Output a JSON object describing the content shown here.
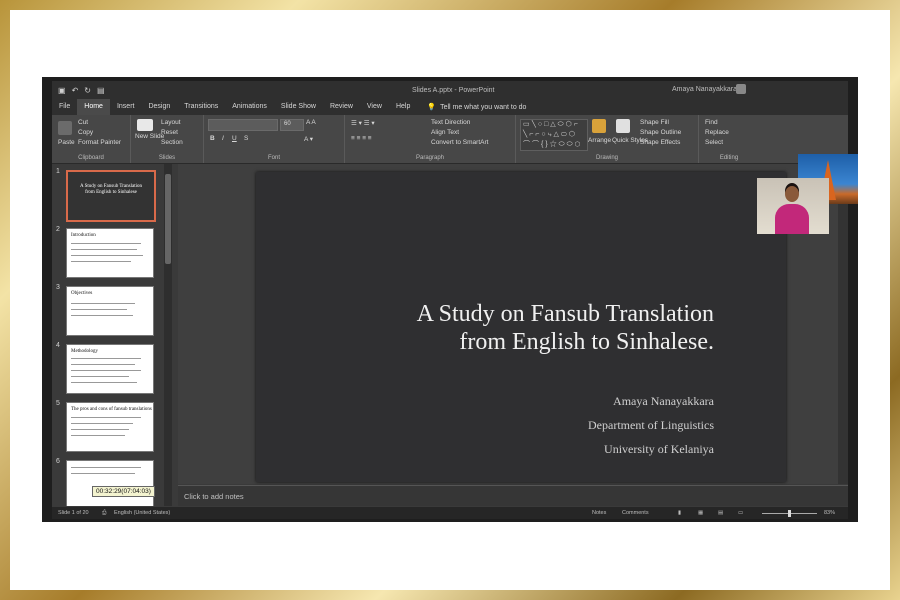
{
  "titlebar": {
    "doc_title": "Slides A.pptx - PowerPoint",
    "user_name": "Amaya Nanayakkara"
  },
  "tabs": [
    "File",
    "Home",
    "Insert",
    "Design",
    "Transitions",
    "Animations",
    "Slide Show",
    "Review",
    "View",
    "Help"
  ],
  "tell_me": "Tell me what you want to do",
  "ribbon": {
    "clipboard": {
      "paste": "Paste",
      "cut": "Cut",
      "copy": "Copy",
      "format_painter": "Format Painter",
      "label": "Clipboard"
    },
    "slides": {
      "new_slide": "New Slide",
      "layout": "Layout",
      "reset": "Reset",
      "section": "Section",
      "label": "Slides"
    },
    "font": {
      "size": "60",
      "label": "Font"
    },
    "paragraph": {
      "text_direction": "Text Direction",
      "align_text": "Align Text",
      "smartart": "Convert to SmartArt",
      "label": "Paragraph"
    },
    "drawing": {
      "arrange": "Arrange",
      "quick_styles": "Quick Styles",
      "shape_fill": "Shape Fill",
      "shape_outline": "Shape Outline",
      "shape_effects": "Shape Effects",
      "label": "Drawing"
    },
    "editing": {
      "find": "Find",
      "replace": "Replace",
      "select": "Select",
      "label": "Editing"
    }
  },
  "thumbnails": [
    {
      "num": "1",
      "title": "A Study on Fansub Translation from English to Sinhalese"
    },
    {
      "num": "2",
      "title": "Introduction"
    },
    {
      "num": "3",
      "title": "Objectives"
    },
    {
      "num": "4",
      "title": "Methodology"
    },
    {
      "num": "5",
      "title": "The pros and cons of fansub translations"
    },
    {
      "num": "6",
      "title": ""
    }
  ],
  "tooltip": "00:32:29(07:04:03)",
  "slide": {
    "title_line1": "A Study on Fansub Translation",
    "title_line2": "from English to Sinhalese.",
    "author": "Amaya Nanayakkara",
    "department": "Department of Linguistics",
    "university": "University of Kelaniya"
  },
  "notes_placeholder": "Click to add notes",
  "status": {
    "slide_count": "Slide 1 of 20",
    "language": "English (United States)",
    "notes": "Notes",
    "comments": "Comments",
    "zoom": "83%"
  }
}
